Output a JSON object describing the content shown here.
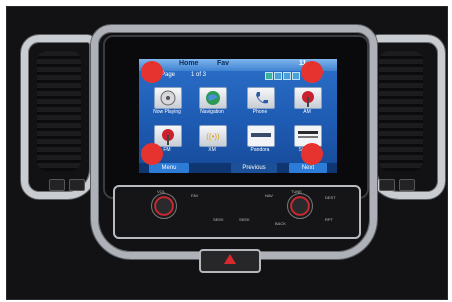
{
  "screen": {
    "tabs": [
      "Home",
      "Fav"
    ],
    "clock": "11",
    "page_label": "Page",
    "page_indicator": "1 of 3",
    "apps": [
      {
        "label": "Now Playing",
        "icon": "disc-icon"
      },
      {
        "label": "Navigation",
        "icon": "globe-icon"
      },
      {
        "label": "Phone",
        "icon": "phone-icon"
      },
      {
        "label": "AM",
        "icon": "radio-tower-icon"
      },
      {
        "label": "FM",
        "icon": "radio-tower-icon"
      },
      {
        "label": "XM",
        "icon": "xm-icon"
      },
      {
        "label": "Pandora",
        "icon": "pandora-icon"
      },
      {
        "label": "Stitcher",
        "icon": "stitcher-icon"
      }
    ],
    "bottom": {
      "left_label": "Menu",
      "previous_label": "Previous",
      "next_label": "Next"
    }
  },
  "controls": {
    "vol_label": "VOL",
    "fav_label": "FAV",
    "nav_label": "NAV",
    "tune_label": "TUNE",
    "back_label": "BACK",
    "seek_back_label": "SEEK",
    "seek_fwd_label": "SEEK",
    "rpt_label": "RPT",
    "dest_label": "DEST"
  },
  "colors": {
    "screen_blue": "#1e5bb3",
    "highlight_dot": "#e7332f",
    "chrome": "#c9ccd1"
  }
}
